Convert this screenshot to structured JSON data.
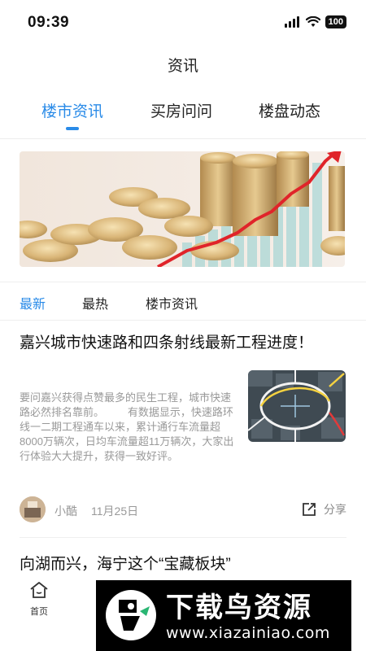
{
  "status_bar": {
    "time": "09:39",
    "battery": "100"
  },
  "header": {
    "title": "资讯"
  },
  "top_tabs": [
    {
      "label": "楼市资讯",
      "active": true
    },
    {
      "label": "买房问问",
      "active": false
    },
    {
      "label": "楼盘动态",
      "active": false
    }
  ],
  "banner": {
    "description_icon": "coins-rising-chart-image"
  },
  "sub_tabs": [
    {
      "label": "最新",
      "active": true
    },
    {
      "label": "最热",
      "active": false
    },
    {
      "label": "楼市资讯",
      "active": false
    }
  ],
  "articles": [
    {
      "title": "嘉兴城市快速路和四条射线最新工程进度！",
      "summary": "要问嘉兴获得点赞最多的民生工程，城市快速路必然排名靠前。        有数据显示，快速路环线一二期工程通车以来，累计通行车流量超8000万辆次，日均车流量超11万辆次，大家出行体验大大提升，获得一致好评。",
      "author": "小酷",
      "date": "11月25日",
      "share_label": "分享"
    },
    {
      "title": "向湖而兴，海宁这个“宝藏板块”"
    }
  ],
  "bottom_nav": {
    "home_label": "首页"
  },
  "watermark": {
    "title": "下载鸟资源",
    "url": "www.xiazainiao.com"
  },
  "colors": {
    "accent": "#2a8be8",
    "muted_text": "#999999"
  }
}
